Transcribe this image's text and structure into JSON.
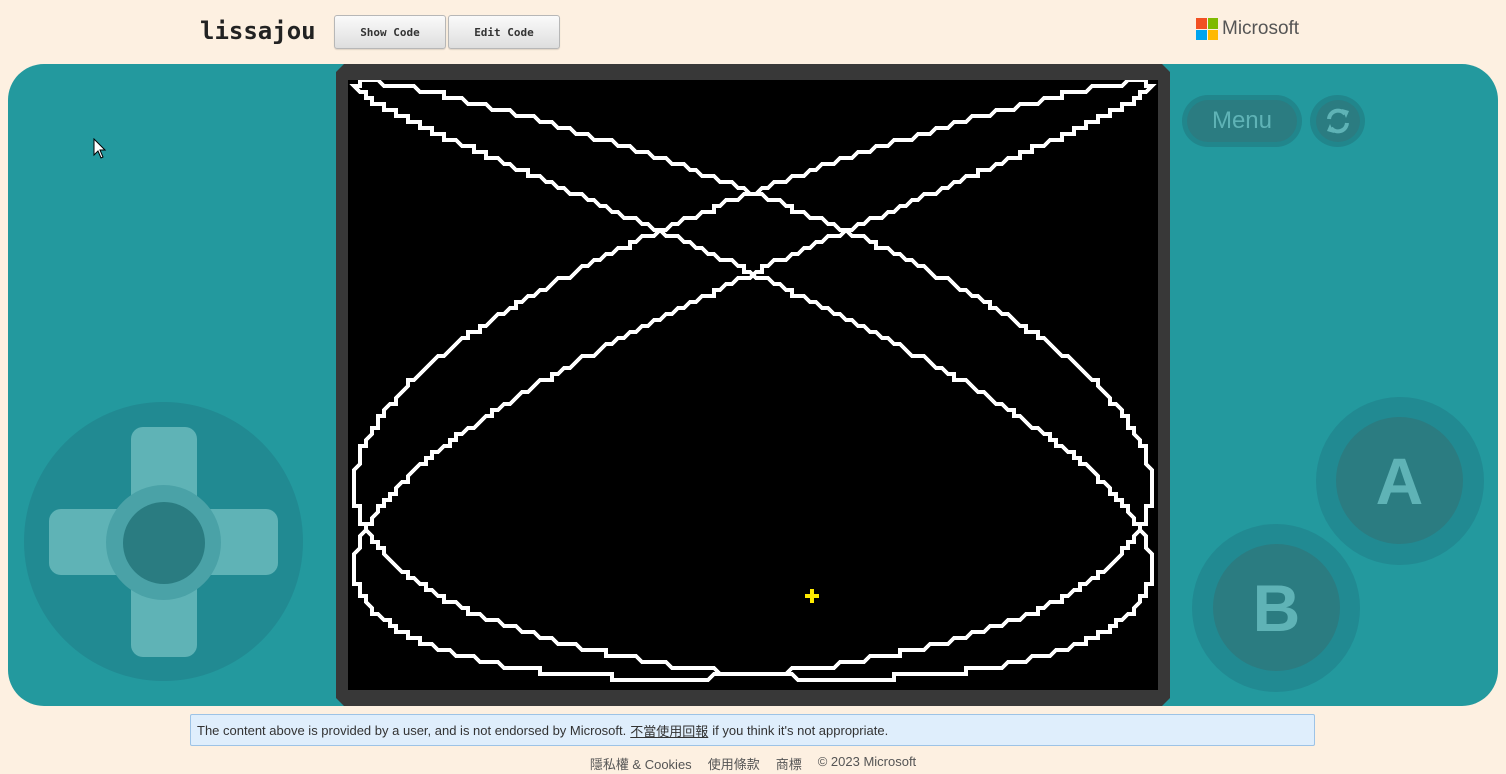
{
  "header": {
    "title": "lissajou",
    "show_code_label": "Show Code",
    "edit_code_label": "Edit Code",
    "brand": "Microsoft"
  },
  "console": {
    "menu_label": "Menu",
    "a_label": "A",
    "b_label": "B"
  },
  "notice": {
    "text_before": "The content above is provided by a user, and is not endorsed by Microsoft.",
    "link": "不當使用回報",
    "text_after": "if you think it's not appropriate."
  },
  "footer": {
    "privacy": "隱私權 & Cookies",
    "terms": "使用條款",
    "trademarks": "商標",
    "copyright": "© 2023 Microsoft"
  },
  "colors": {
    "page_bg": "#fdf0e1",
    "console": "#23999e",
    "ms_red": "#f25022",
    "ms_green": "#7fba00",
    "ms_blue": "#00a4ef",
    "ms_yellow": "#ffb900",
    "cursor_plus": "#ffea00"
  }
}
